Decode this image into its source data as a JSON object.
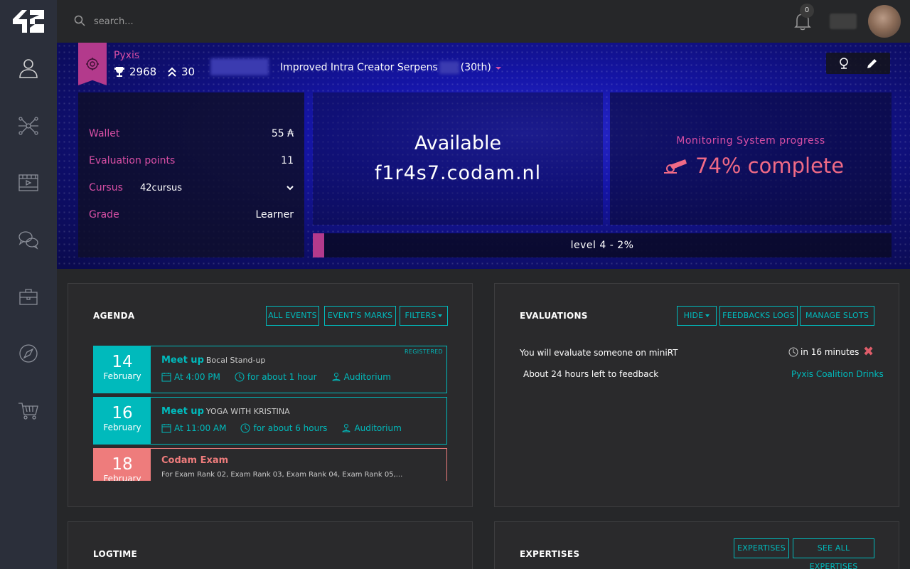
{
  "colors": {
    "accent": "#00babc",
    "coalition": "#d94fa5",
    "exam": "#ee7c7c",
    "sidebar": "#2b2f3a"
  },
  "sidebar": {
    "logo": "42",
    "items": [
      {
        "icon": "user-icon"
      },
      {
        "icon": "holy-graph-icon"
      },
      {
        "icon": "elearning-icon"
      },
      {
        "icon": "forum-icon"
      },
      {
        "icon": "companies-icon"
      },
      {
        "icon": "compass-icon"
      },
      {
        "icon": "shop-icon"
      }
    ]
  },
  "topbar": {
    "search_placeholder": "search...",
    "notifications_count": "0"
  },
  "hero": {
    "coalition": "Pyxis",
    "correction_points_score": "2968",
    "rank": "30",
    "title": "Improved Intra Creator Serpens",
    "title_rank": "(30th)",
    "info": {
      "wallet_label": "Wallet",
      "wallet_value": "55 ₳",
      "eval_label": "Evaluation points",
      "eval_value": "11",
      "cursus_label": "Cursus",
      "cursus_value": "42cursus",
      "grade_label": "Grade",
      "grade_value": "Learner"
    },
    "host": {
      "status": "Available",
      "name": "f1r4s7.codam.nl"
    },
    "monitoring": {
      "label": "Monitoring System progress",
      "value": "74% complete"
    },
    "level": {
      "text": "level 4 - 2%",
      "progress": 0.02
    }
  },
  "agenda": {
    "title": "AGENDA",
    "buttons": {
      "all_events": "ALL EVENTS",
      "marks": "EVENT'S MARKS",
      "filters": "FILTERS"
    },
    "events": [
      {
        "day": "14",
        "month": "February",
        "kind": "Meet up",
        "name": "Bocal Stand-up",
        "time": "At 4:00 PM",
        "duration": "for about 1 hour",
        "location": "Auditorium",
        "badge": "REGISTERED"
      },
      {
        "day": "16",
        "month": "February",
        "kind": "Meet up",
        "name": "YOGA WITH KRISTINA",
        "time": "At 11:00 AM",
        "duration": "for about 6 hours",
        "location": "Auditorium"
      },
      {
        "day": "18",
        "month": "February",
        "kind": "Codam Exam",
        "desc": "For Exam Rank 02, Exam Rank 03, Exam Rank 04, Exam Rank 05,..."
      }
    ]
  },
  "evaluations": {
    "title": "EVALUATIONS",
    "buttons": {
      "hide": "HIDE",
      "feedbacks": "FEEDBACKS LOGS",
      "slots": "MANAGE SLOTS"
    },
    "items": [
      {
        "text": "You will evaluate someone on miniRT",
        "time": "in 16 minutes"
      },
      {
        "text": "About 24 hours left to feedback",
        "link": "Pyxis Coalition Drinks"
      }
    ]
  },
  "logtime": {
    "title": "LOGTIME"
  },
  "expertises": {
    "title": "EXPERTISES",
    "buttons": {
      "expertises": "EXPERTISES",
      "see_all": "SEE ALL EXPERTISES"
    }
  }
}
